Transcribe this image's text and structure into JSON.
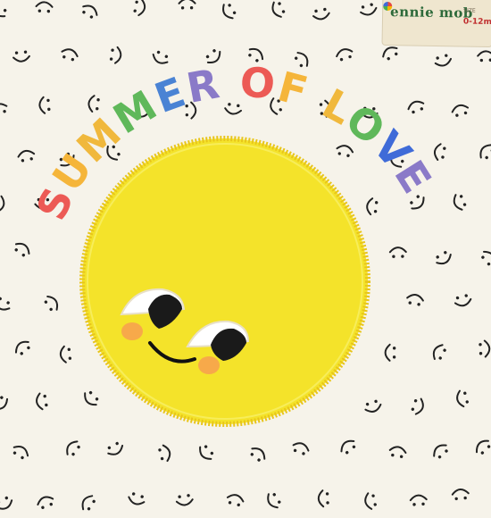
{
  "embroidery": {
    "text": "SUMMER OF LOVE",
    "letters": [
      {
        "ch": "S",
        "color": "#ec5a55"
      },
      {
        "ch": "U",
        "color": "#f5b53a"
      },
      {
        "ch": "M",
        "color": "#f0b83c"
      },
      {
        "ch": "M",
        "color": "#5fb85a"
      },
      {
        "ch": "E",
        "color": "#4a83d4"
      },
      {
        "ch": "R",
        "color": "#8a7ac8"
      },
      {
        "ch": " ",
        "color": "#000000"
      },
      {
        "ch": "O",
        "color": "#ec5a55"
      },
      {
        "ch": "F",
        "color": "#f5b53a"
      },
      {
        "ch": " ",
        "color": "#000000"
      },
      {
        "ch": "L",
        "color": "#f0b83c"
      },
      {
        "ch": "O",
        "color": "#5fb85a"
      },
      {
        "ch": "V",
        "color": "#3f6bd8"
      },
      {
        "ch": "E",
        "color": "#8a7ac8"
      }
    ]
  },
  "label": {
    "brand": "ennie mob",
    "size_key": "SIZE",
    "size_value": "0-12m"
  },
  "colors": {
    "fabric": "#f6f3ea",
    "sun": "#f4e32a",
    "sun_stitch": "#e8c51a",
    "pattern": "#222222",
    "cheek": "#f7a94a"
  },
  "icons": {
    "pattern": "smiley-face-icon",
    "sun": "sun-face-icon"
  }
}
